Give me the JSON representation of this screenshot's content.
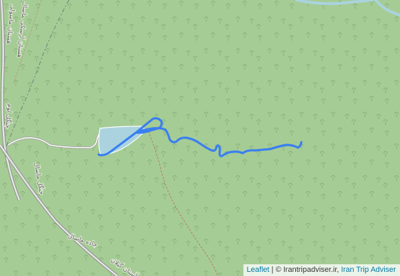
{
  "map": {
    "labels": [
      "هستان آرسکی ماسال",
      "هستان ماسولی",
      "جنگل ماسال",
      "جنگل لوم",
      "جاده ماسال",
      "آستان گیلان"
    ]
  },
  "attribution": {
    "leaflet": "Leaflet",
    "separator": "| ©",
    "site": "Irantripadviser.ir,",
    "brand": "Iran Trip Adviser"
  },
  "colors": {
    "background": "#a6cc96",
    "forest_pattern": "#85ae74",
    "lake": "#aad3df",
    "track": "#3a7ff0",
    "river": "#aad3df",
    "road_casing": "#8c8c8c"
  },
  "icons": {
    "forest": "tree-icon"
  }
}
